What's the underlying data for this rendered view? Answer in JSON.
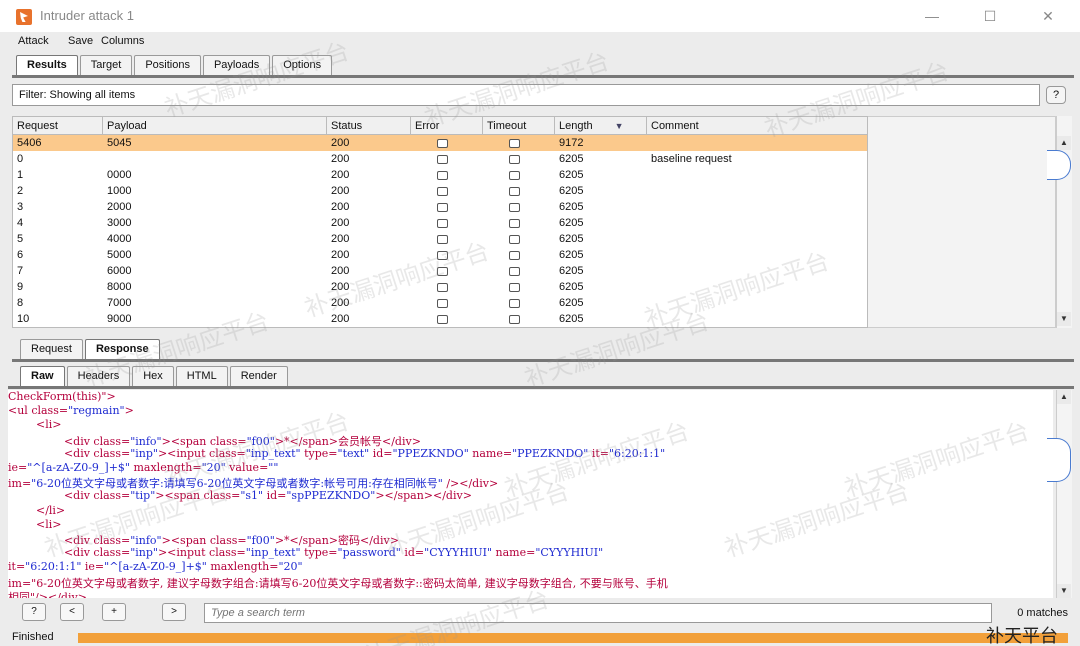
{
  "window": {
    "title": "Intruder attack 1",
    "minimize": "—",
    "maximize": "☐",
    "close": "✕"
  },
  "menu": [
    "Attack",
    "Save",
    "Columns"
  ],
  "main_tabs": [
    "Results",
    "Target",
    "Positions",
    "Payloads",
    "Options"
  ],
  "filter": {
    "text": "Filter: Showing all items",
    "help": "?"
  },
  "table": {
    "columns": [
      "Request",
      "Payload",
      "Status",
      "Error",
      "Timeout",
      "Length",
      "Comment"
    ],
    "sort_indicator": "▼",
    "rows": [
      {
        "request": "5406",
        "payload": "5045",
        "status": "200",
        "length": "9172",
        "comment": ""
      },
      {
        "request": "0",
        "payload": "",
        "status": "200",
        "length": "6205",
        "comment": "baseline request"
      },
      {
        "request": "1",
        "payload": "0000",
        "status": "200",
        "length": "6205",
        "comment": ""
      },
      {
        "request": "2",
        "payload": "1000",
        "status": "200",
        "length": "6205",
        "comment": ""
      },
      {
        "request": "3",
        "payload": "2000",
        "status": "200",
        "length": "6205",
        "comment": ""
      },
      {
        "request": "4",
        "payload": "3000",
        "status": "200",
        "length": "6205",
        "comment": ""
      },
      {
        "request": "5",
        "payload": "4000",
        "status": "200",
        "length": "6205",
        "comment": ""
      },
      {
        "request": "6",
        "payload": "5000",
        "status": "200",
        "length": "6205",
        "comment": ""
      },
      {
        "request": "7",
        "payload": "6000",
        "status": "200",
        "length": "6205",
        "comment": ""
      },
      {
        "request": "9",
        "payload": "8000",
        "status": "200",
        "length": "6205",
        "comment": ""
      },
      {
        "request": "8",
        "payload": "7000",
        "status": "200",
        "length": "6205",
        "comment": ""
      },
      {
        "request": "10",
        "payload": "9000",
        "status": "200",
        "length": "6205",
        "comment": ""
      }
    ],
    "selected_row": 0
  },
  "req_resp_tabs": [
    "Request",
    "Response"
  ],
  "view_tabs": [
    "Raw",
    "Headers",
    "Hex",
    "HTML",
    "Render"
  ],
  "code_lines": [
    "CheckForm(this)\">",
    "<ul class=\"regmain\">",
    "        <li>",
    "                <div class=\"info\"><span class=\"f00\">*</span>会员帐号</div>",
    "                <div class=\"inp\"><input class=\"inp_text\" type=\"text\" id=\"PPEZKNDO\" name=\"PPEZKNDO\" it=\"6:20:1:1\"",
    "ie=\"^[a-zA-Z0-9_]+$\" maxlength=\"20\" value=\"\"",
    "im=\"6-20位英文字母或者数字:请填写6-20位英文字母或者数字:帐号可用:存在相同帐号\" /></div>",
    "                <div class=\"tip\"><span class=\"s1\" id=\"spPPEZKNDO\"></span></div>",
    "        </li>",
    "        <li>",
    "                <div class=\"info\"><span class=\"f00\">*</span>密码</div>",
    "                <div class=\"inp\"><input class=\"inp_text\" type=\"password\" id=\"CYYYHIUI\" name=\"CYYYHIUI\"",
    "it=\"6:20:1:1\" ie=\"^[a-zA-Z0-9_]+$\" maxlength=\"20\"",
    "im=\"6-20位英文字母或者数字, 建议字母数字组合:请填写6-20位英文字母或者数字::密码太简单, 建议字母数字组合, 不要与账号、手机",
    "相同\"/></div>"
  ],
  "search": {
    "help": "?",
    "prev": "<",
    "add": "+",
    "next": ">",
    "placeholder": "Type a search term",
    "matches": "0 matches"
  },
  "status": {
    "text": "Finished",
    "progress": 1.0
  },
  "watermark": "补天漏洞响应平台",
  "watermark_corner": "补天平台",
  "colors": {
    "selected_row": "#fbc98c",
    "progress": "#f2a03a",
    "code_tag": "#b4003c",
    "code_value": "#1f2bd1"
  },
  "icons": {
    "app": "burp-logo-icon",
    "help": "question-icon",
    "scroll_up": "arrow-up-icon",
    "scroll_down": "arrow-down-icon"
  }
}
